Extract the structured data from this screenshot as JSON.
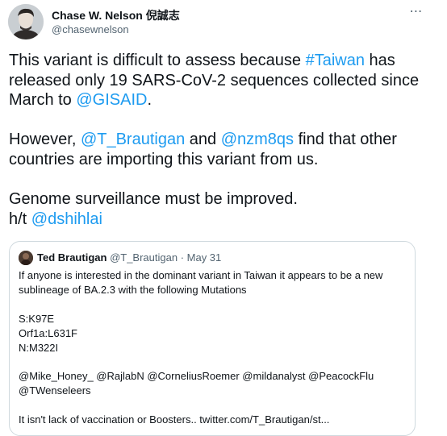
{
  "author": {
    "name": "Chase W. Nelson 倪誠志",
    "handle": "@chasewnelson"
  },
  "more_icon": "⋯",
  "tweet": {
    "p1": {
      "t1": "This variant is difficult to assess because ",
      "l1": "#Taiwan",
      "t2": " has released only 19 SARS-CoV-2 sequences collected since March to ",
      "l2": "@GISAID",
      "t3": "."
    },
    "p2": {
      "t1": "However, ",
      "l1": "@T_Brautigan",
      "t2": " and ",
      "l2": "@nzm8qs",
      "t3": " find that other countries are importing this variant from us."
    },
    "p3": {
      "line1": "Genome surveillance must be improved.",
      "t1": "h/t ",
      "l1": "@dshihlai"
    }
  },
  "quote": {
    "name": "Ted Brautigan",
    "meta": "@T_Brautigan · May 31",
    "intro": "If anyone is interested in the dominant variant in Taiwan it appears to be a new sublineage of BA.2.3 with the following Mutations",
    "mutations": [
      "S:K97E",
      "Orf1a:L631F",
      "N:M322I"
    ],
    "mentions": "@Mike_Honey_ @RajlabN @CorneliusRoemer @mildanalyst @PeacockFlu @TWenseleers",
    "tail": "It isn't lack of vaccination or Boosters.. twitter.com/T_Brautigan/st..."
  }
}
